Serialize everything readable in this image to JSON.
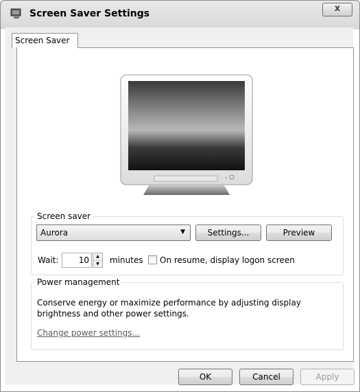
{
  "window": {
    "title": "Screen Saver Settings",
    "close_label": "x"
  },
  "tabs": [
    {
      "label": "Screen Saver"
    }
  ],
  "screen_saver": {
    "group_label": "Screen saver",
    "selected": "Aurora",
    "settings_label": "Settings...",
    "preview_label": "Preview",
    "wait_label": "Wait:",
    "wait_value": "10",
    "minutes_label": "minutes",
    "resume_label": "On resume, display logon screen",
    "resume_checked": false
  },
  "power": {
    "group_label": "Power management",
    "description_line1": "Conserve energy or maximize performance by adjusting display",
    "description_line2": "brightness and other power settings.",
    "link_label": "Change power settings..."
  },
  "footer": {
    "ok_label": "OK",
    "cancel_label": "Cancel",
    "apply_label": "Apply",
    "apply_enabled": false
  },
  "icons": {
    "app": "screen-saver-app-icon",
    "dropdown": "chevron-down-icon",
    "spin_up": "spin-up-icon",
    "spin_down": "spin-down-icon"
  }
}
